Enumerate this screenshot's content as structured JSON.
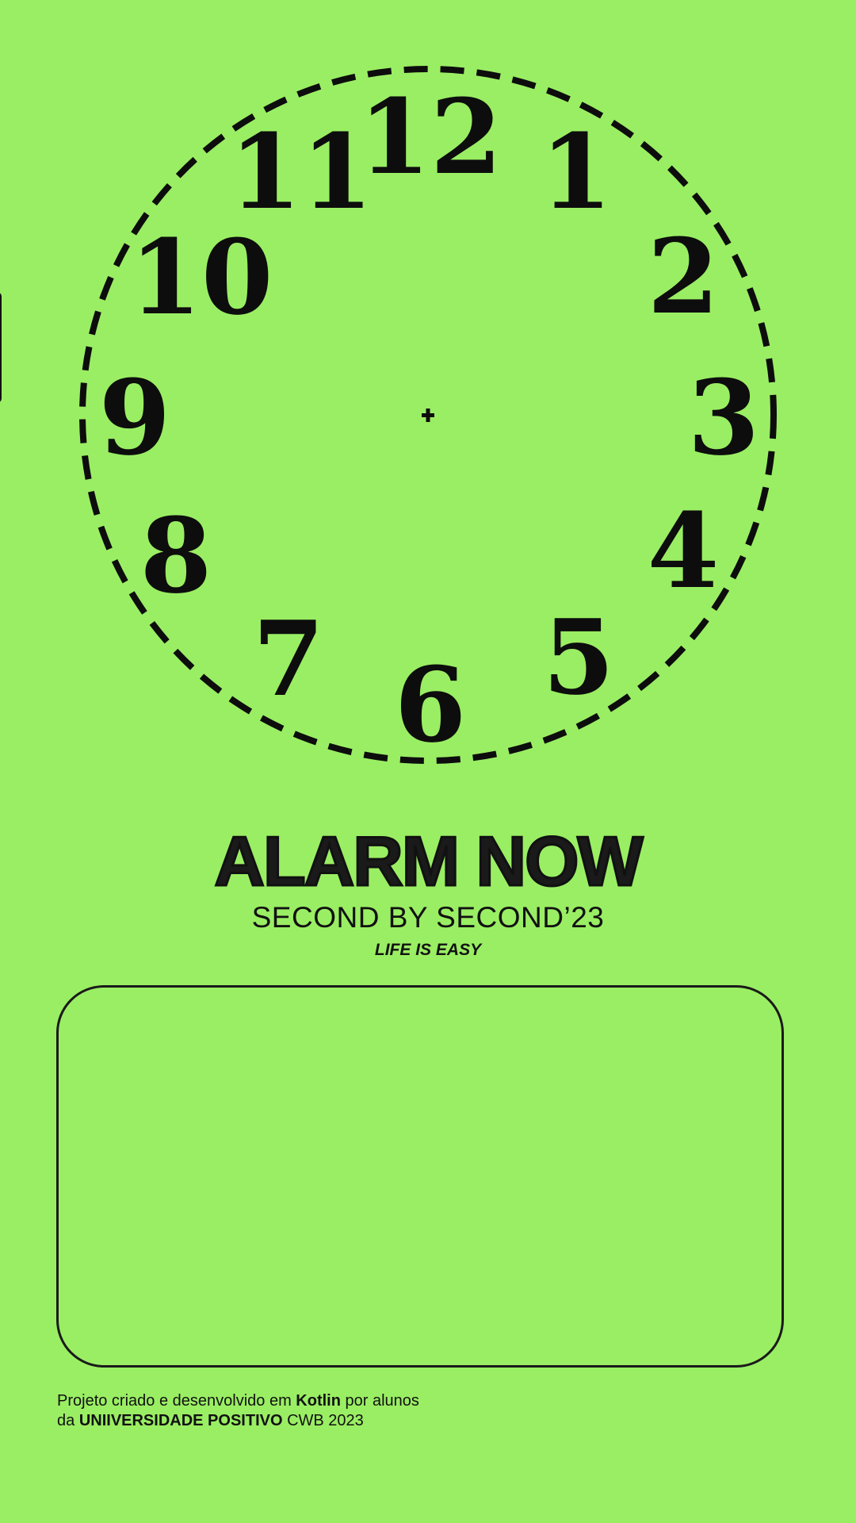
{
  "clock": {
    "numbers": [
      "12",
      "1",
      "2",
      "3",
      "4",
      "5",
      "6",
      "7",
      "8",
      "9",
      "10",
      "11"
    ]
  },
  "header": {
    "title": "ALARM NOW",
    "subtitle": "SECOND BY SECOND’23",
    "tagline": "LIFE IS EASY"
  },
  "footer": {
    "line1_prefix": "Projeto criado e desenvolvido em ",
    "line1_bold": "Kotlin",
    "line1_suffix": " por alunos",
    "line2_prefix": "da ",
    "line2_bold": "UNIIVERSIDADE POSITIVO",
    "line2_suffix": " CWB 2023"
  },
  "colors": {
    "background": "#9aee63",
    "ink": "#111111"
  }
}
